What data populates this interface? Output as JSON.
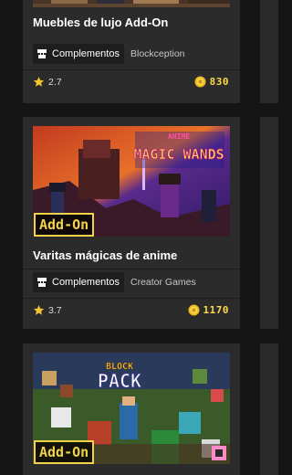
{
  "cards": [
    {
      "title": "Muebles de lujo Add-On",
      "category": "Complementos",
      "creator": "Blockception",
      "rating": "2.7",
      "price": "830"
    },
    {
      "title": "Varitas mágicas de anime",
      "category": "Complementos",
      "creator": "Creator Games",
      "rating": "3.7",
      "price": "1170",
      "badge": "Add-On",
      "art_text": [
        "ANIME",
        "MAGIC WANDS"
      ]
    },
    {
      "badge": "Add-On",
      "art_text": [
        "BLOCK",
        "PACK"
      ]
    }
  ],
  "icons": {
    "category": "addon-puzzle-icon",
    "rating": "star-icon",
    "price": "minecoin-icon"
  },
  "colors": {
    "background": "#151515",
    "card": "#2b2b2b",
    "price": "#ffd84a",
    "star": "#f4c531",
    "badge": "#f1d34b"
  }
}
